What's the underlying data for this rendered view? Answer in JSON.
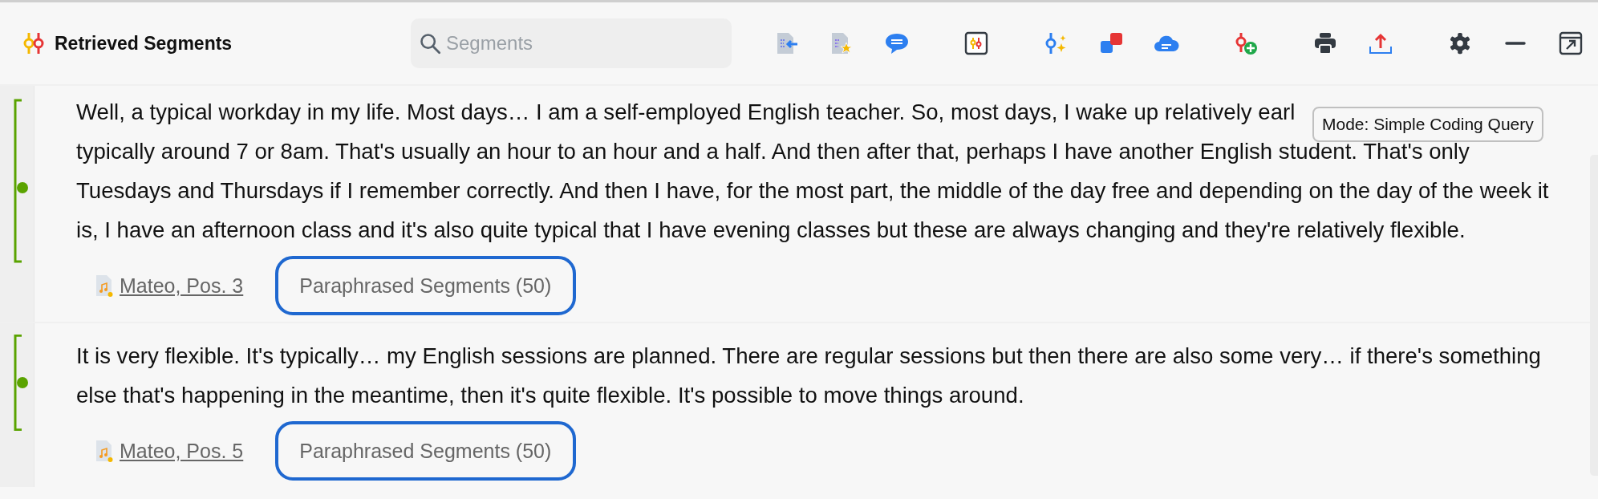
{
  "title": "Retrieved Segments",
  "search": {
    "placeholder": "Segments"
  },
  "tooltip": "Mode: Simple Coding Query",
  "segments": [
    {
      "lines": [
        "Well, a typical workday in my life. Most days… I am a self-employed English teacher. So, most days, I wake up relatively earl",
        "typically around 7 or 8am. That's usually an hour to an hour and a half. And then after that, perhaps I have another English student. That's only",
        "Tuesdays and Thursdays if I remember correctly. And then I have, for the most part, the middle of the day free and depending on the day of the week it",
        "is, I have an afternoon class and it's also quite typical that I have evening classes but these are always changing and they're relatively flexible."
      ],
      "source": "Mateo, Pos. 3",
      "code": "Paraphrased Segments (50)"
    },
    {
      "lines": [
        "It is very flexible. It's typically… my English sessions are planned. There are regular sessions but then there are also some very… if there's something",
        "else that's happening in the meantime, then it's quite flexible. It's possible to move things around."
      ],
      "source": "Mateo, Pos. 5",
      "code": "Paraphrased Segments (50)"
    }
  ]
}
